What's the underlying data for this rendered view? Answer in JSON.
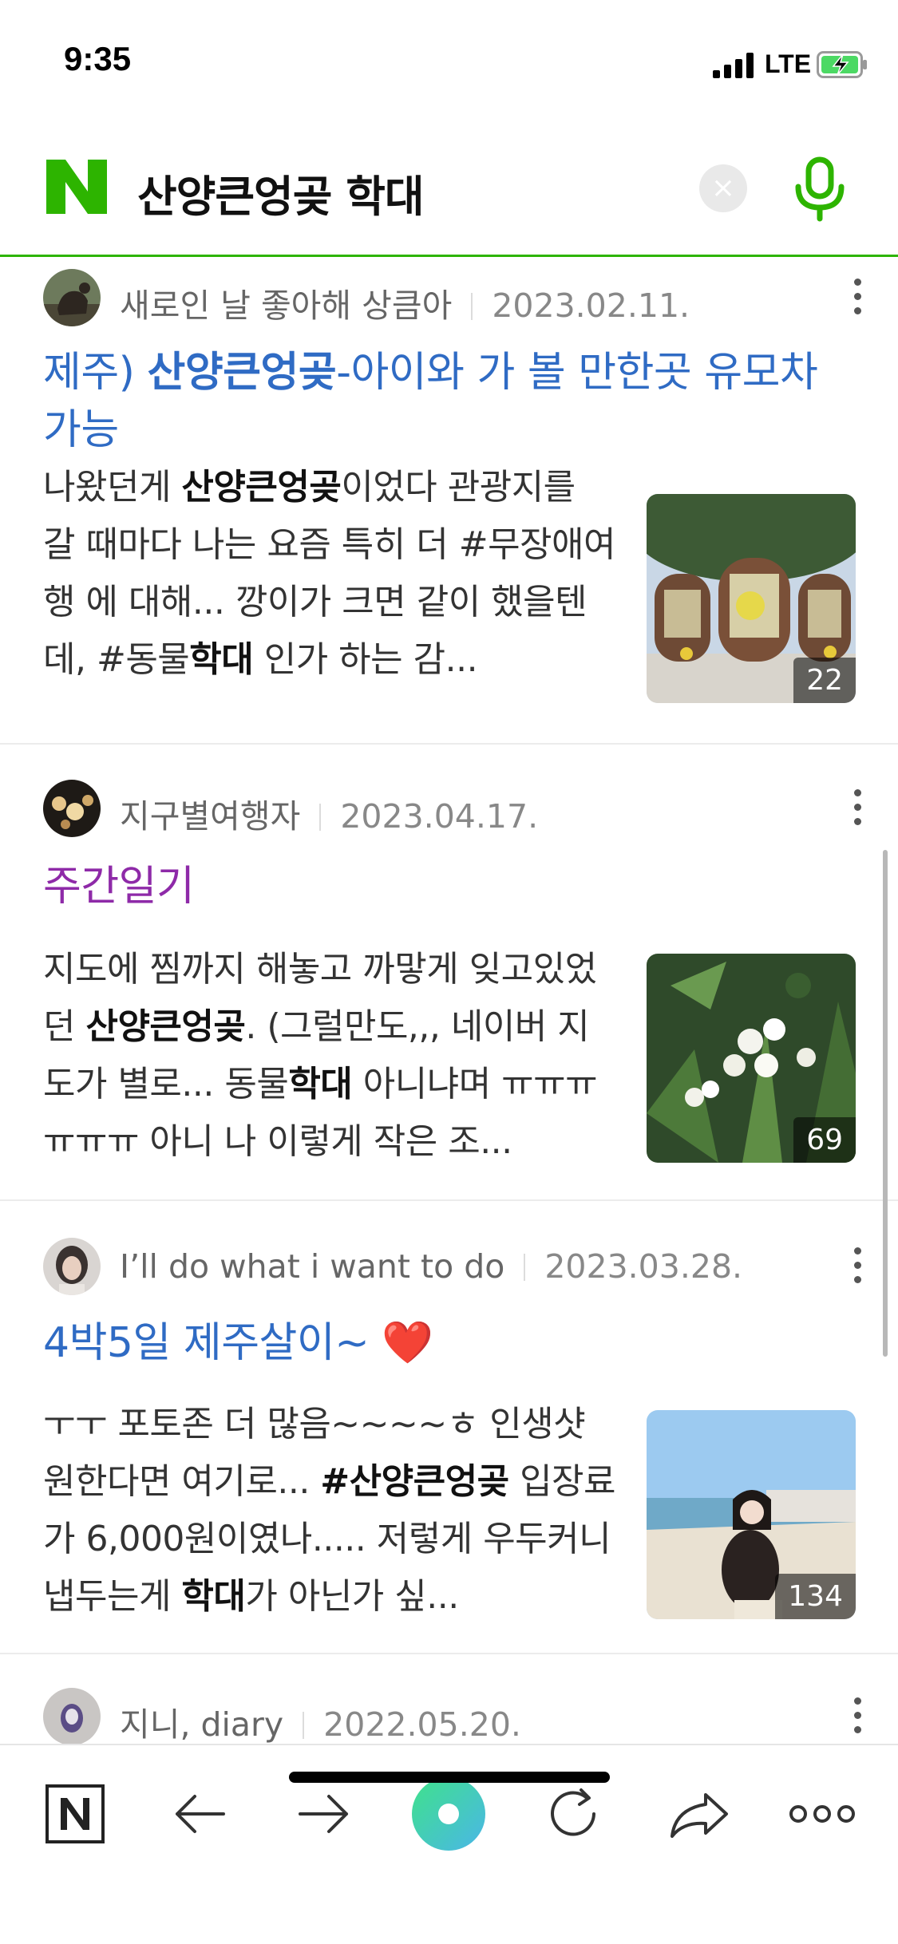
{
  "status_bar": {
    "time": "9:35",
    "network": "LTE"
  },
  "search": {
    "query": "산양큰엉곶 학대"
  },
  "colors": {
    "brand_green": "#2db400",
    "link_blue": "#2f6bc4",
    "visited_purple": "#8e2aa8"
  },
  "results": [
    {
      "author": "새로인 날 좋아해 상큼아",
      "date": "2023.02.11.",
      "title_parts": [
        "제주) ",
        "산양큰엉곶",
        "-아이와 가 볼 만한곳 유모차 가능"
      ],
      "snippet_parts": [
        "나왔던게 ",
        "산양큰엉곶",
        "이었다 관광지를 갈 때마다 나는 요즘 특히 더 #무장애여행 에 대해... 깡이가 크면 같이 했을텐데, #동물",
        "학대",
        " 인가 하는 감..."
      ],
      "photo_count": "22"
    },
    {
      "author": "지구별여행자",
      "date": "2023.04.17.",
      "title": "주간일기",
      "snippet_parts": [
        "지도에 찜까지 해놓고 까맣게 잊고있었던 ",
        "산양큰엉곶",
        ". (그럴만도,,, 네이버 지도가 별로... 동물",
        "학대",
        " 아니냐며 ㅠㅠㅠㅠㅠㅠ 아니 나 이렇게 작은 조..."
      ],
      "photo_count": "69"
    },
    {
      "author": "I’ll do what i want to do",
      "date": "2023.03.28.",
      "title": "4박5일 제주살이~ ❤️",
      "snippet_parts": [
        "ㅜㅜ 포토존 더 많음~~~~ㅎ 인생샷 원한다면 여기로... ",
        "#산양큰엉곶",
        " 입장료가 6,000원이였나..... 저렇게 우두커니 냅두는게 ",
        "학대",
        "가 아닌가 싶..."
      ],
      "photo_count": "134"
    },
    {
      "author": "지니, diary",
      "date": "2022.05.20."
    }
  ],
  "bottom_bar": {
    "items": [
      "naver-home-icon",
      "back-arrow-icon",
      "forward-arrow-icon",
      "green-dot-icon",
      "refresh-icon",
      "share-icon",
      "more-horizontal-icon"
    ]
  }
}
